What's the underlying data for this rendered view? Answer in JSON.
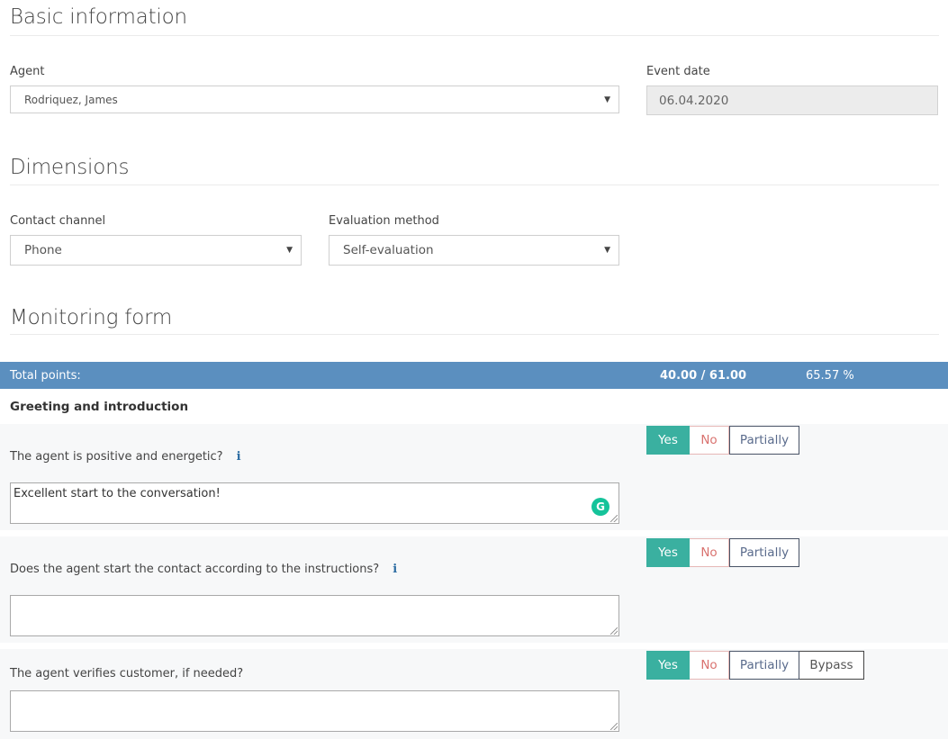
{
  "basic_info": {
    "title": "Basic information",
    "agent_label": "Agent",
    "agent_value": "Rodriquez, James",
    "event_date_label": "Event date",
    "event_date_value": "06.04.2020"
  },
  "dimensions": {
    "title": "Dimensions",
    "contact_channel_label": "Contact channel",
    "contact_channel_value": "Phone",
    "evaluation_method_label": "Evaluation method",
    "evaluation_method_value": "Self-evaluation"
  },
  "monitoring": {
    "title": "Monitoring form",
    "total_label": "Total points:",
    "total_points": "40.00 / 61.00",
    "total_percent": "65.57 %",
    "group_title": "Greeting and introduction",
    "questions": [
      {
        "text": "The agent is positive and energetic?",
        "has_info": true,
        "comment": "Excellent start to the conversation!",
        "selected": "Yes",
        "options": [
          "Yes",
          "No",
          "Partially"
        ]
      },
      {
        "text": "Does the agent start the contact according to the instructions?",
        "has_info": true,
        "comment": "",
        "selected": "Yes",
        "options": [
          "Yes",
          "No",
          "Partially"
        ]
      },
      {
        "text": "The agent verifies customer, if needed?",
        "has_info": false,
        "comment": "",
        "selected": "Yes",
        "options": [
          "Yes",
          "No",
          "Partially",
          "Bypass"
        ]
      }
    ]
  },
  "icons": {
    "caret": "▼",
    "info": "i",
    "grammarly": "G"
  },
  "colors": {
    "total_bar": "#5b8fbf",
    "yes_selected": "#3ab0a0",
    "no_text": "#d9726f",
    "grammarly": "#15c39a",
    "info_icon": "#2d6da3"
  }
}
